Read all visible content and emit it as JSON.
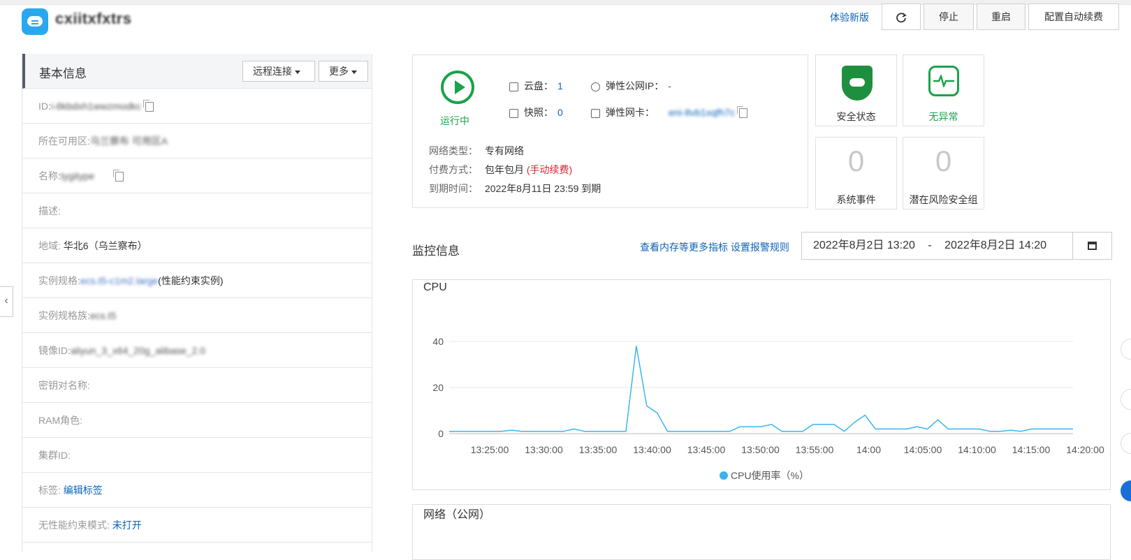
{
  "header": {
    "app_name": "cxiitxfxtrs",
    "try_new": "体验新版",
    "refresh_icon": "refresh-icon",
    "stop": "停止",
    "restart": "重启",
    "auto_renew": "配置自动续费"
  },
  "basic": {
    "title": "基本信息",
    "remote": "远程连接",
    "more": "更多",
    "rows": [
      {
        "label": "ID:",
        "value": "i-8kbdxh1wwzmodkc"
      },
      {
        "label": "所在可用区:",
        "value": "乌兰察布 可用区A"
      },
      {
        "label": "名称:",
        "value": "tygitype"
      },
      {
        "label": "描述:",
        "value": ""
      },
      {
        "label": "地域:",
        "value": "华北6（乌兰察布）"
      },
      {
        "label": "实例规格:",
        "value": "ecs.t5-c1m2.large",
        "suffix": "(性能约束实例)"
      },
      {
        "label": "实例规格族:",
        "value": "ecs.t5"
      },
      {
        "label": "镜像ID:",
        "value": "aliyun_3_x64_20g_alibase_2.0"
      },
      {
        "label": "密钥对名称:",
        "value": ""
      },
      {
        "label": "RAM角色:",
        "value": ""
      },
      {
        "label": "集群ID:",
        "value": ""
      },
      {
        "label": "标签:",
        "link": "编辑标签"
      },
      {
        "label": "无性能约束模式:",
        "link": "未打开"
      }
    ]
  },
  "status": {
    "running": "运行中",
    "disk_label": "云盘：",
    "disk_count": "1",
    "snapshot_label": "快照：",
    "snapshot_count": "0",
    "eip_label": "弹性公网IP：",
    "eip_value": "-",
    "eni_label": "弹性网卡：",
    "eni_value": "eni-8vb1xqfh7c",
    "network_type_label": "网络类型：",
    "network_type": "专有网络",
    "billing_label": "付费方式：",
    "billing": "包年包月",
    "billing_note": "(手动续费)",
    "expire_label": "到期时间：",
    "expire": "2022年8月11日 23:59 到期"
  },
  "tiles": {
    "security": "安全状态",
    "no_anomaly": "无异常",
    "system_events_count": "0",
    "system_events": "系统事件",
    "risk_groups_count": "0",
    "risk_groups": "潜在风险安全组"
  },
  "monitor": {
    "title": "监控信息",
    "more_metrics": "查看内存等更多指标",
    "alarm_rules": "设置报警规则",
    "range_start": "2022年8月2日 13:20",
    "range_sep": "-",
    "range_end": "2022年8月2日 14:20",
    "network_title": "网络（公网）"
  },
  "chart_data": {
    "type": "line",
    "title": "CPU",
    "x_ticks": [
      "13:25:00",
      "13:30:00",
      "13:35:00",
      "13:40:00",
      "13:45:00",
      "13:50:00",
      "13:55:00",
      "14:00",
      "14:05:00",
      "14:10:00",
      "14:15:00",
      "14:20:00"
    ],
    "ylim": [
      0,
      40
    ],
    "y_ticks": [
      0,
      20,
      40
    ],
    "legend": "CPU使用率（%）",
    "color": "#3bb4ee",
    "grid": true,
    "series": [
      {
        "name": "CPU使用率（%）",
        "x_minutes": [
          0,
          4,
          6,
          8,
          10,
          12,
          14,
          16,
          18,
          20,
          22,
          24,
          25,
          26,
          27,
          28,
          29,
          30,
          31,
          32,
          33,
          34,
          35,
          36,
          37,
          38,
          39,
          40,
          41,
          42,
          43,
          44,
          45,
          46,
          47,
          48,
          49,
          50,
          51,
          52,
          53,
          54,
          55,
          56,
          57,
          58,
          59,
          60
        ],
        "values": [
          1,
          1,
          1,
          1,
          1,
          1,
          1.5,
          1,
          1,
          1,
          1,
          1,
          2,
          1,
          1,
          1,
          1,
          1,
          38,
          12,
          9,
          1,
          1,
          1,
          1,
          1,
          1,
          1,
          3,
          3,
          3,
          4,
          1,
          1,
          1,
          4,
          4,
          4,
          1,
          5,
          8,
          2,
          2,
          2,
          2,
          3,
          2,
          6,
          2,
          2,
          2,
          2,
          1,
          1,
          1.5,
          1,
          2,
          2,
          2,
          2,
          2
        ]
      }
    ]
  }
}
